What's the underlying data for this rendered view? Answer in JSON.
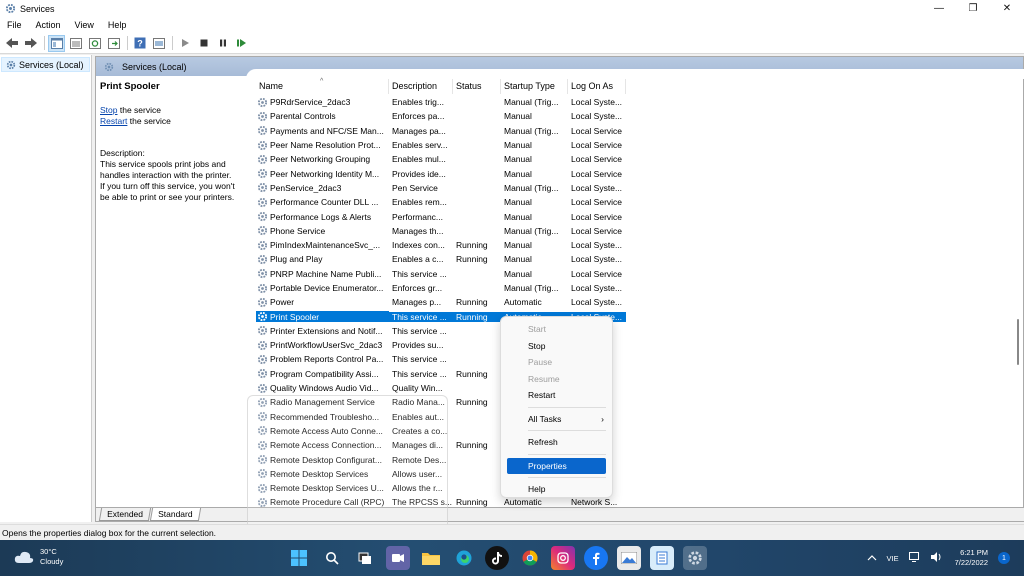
{
  "window": {
    "title": "Services",
    "minimize_glyph": "—",
    "maximize_glyph": "❐",
    "close_glyph": "✕"
  },
  "menu": [
    "File",
    "Action",
    "View",
    "Help"
  ],
  "tree": {
    "root_label": "Services (Local)"
  },
  "content": {
    "header": "Services (Local)",
    "desc_title": "Print Spooler",
    "stop_link": "Stop",
    "stop_suffix": " the service",
    "restart_link": "Restart",
    "restart_suffix": " the service",
    "description_label": "Description:",
    "description_lines": [
      "This service spools print jobs and",
      "handles interaction with the printer.",
      "If you turn off this service, you won't",
      "be able to print or see your printers."
    ]
  },
  "columns": [
    "Name",
    "Description",
    "Status",
    "Startup Type",
    "Log On As"
  ],
  "rows": [
    [
      "P9RdrService_2dac3",
      "Enables trig...",
      "",
      "Manual (Trig...",
      "Local Syste..."
    ],
    [
      "Parental Controls",
      "Enforces pa...",
      "",
      "Manual",
      "Local Syste..."
    ],
    [
      "Payments and NFC/SE Man...",
      "Manages pa...",
      "",
      "Manual (Trig...",
      "Local Service"
    ],
    [
      "Peer Name Resolution Prot...",
      "Enables serv...",
      "",
      "Manual",
      "Local Service"
    ],
    [
      "Peer Networking Grouping",
      "Enables mul...",
      "",
      "Manual",
      "Local Service"
    ],
    [
      "Peer Networking Identity M...",
      "Provides ide...",
      "",
      "Manual",
      "Local Service"
    ],
    [
      "PenService_2dac3",
      "Pen Service",
      "",
      "Manual (Trig...",
      "Local Syste..."
    ],
    [
      "Performance Counter DLL ...",
      "Enables rem...",
      "",
      "Manual",
      "Local Service"
    ],
    [
      "Performance Logs & Alerts",
      "Performanc...",
      "",
      "Manual",
      "Local Service"
    ],
    [
      "Phone Service",
      "Manages th...",
      "",
      "Manual (Trig...",
      "Local Service"
    ],
    [
      "PimIndexMaintenanceSvc_...",
      "Indexes con...",
      "Running",
      "Manual",
      "Local Syste..."
    ],
    [
      "Plug and Play",
      "Enables a c...",
      "Running",
      "Manual",
      "Local Syste..."
    ],
    [
      "PNRP Machine Name Publi...",
      "This service ...",
      "",
      "Manual",
      "Local Service"
    ],
    [
      "Portable Device Enumerator...",
      "Enforces gr...",
      "",
      "Manual (Trig...",
      "Local Syste..."
    ],
    [
      "Power",
      "Manages p...",
      "Running",
      "Automatic",
      "Local Syste..."
    ],
    [
      "Print Spooler",
      "This service ...",
      "Running",
      "Automatic",
      "Local Syste..."
    ],
    [
      "Printer Extensions and Notif...",
      "This service ...",
      "",
      "",
      ""
    ],
    [
      "PrintWorkflowUserSvc_2dac3",
      "Provides su...",
      "",
      "",
      ""
    ],
    [
      "Problem Reports Control Pa...",
      "This service ...",
      "",
      "",
      ""
    ],
    [
      "Program Compatibility Assi...",
      "This service ...",
      "Running",
      "",
      ""
    ],
    [
      "Quality Windows Audio Vid...",
      "Quality Win...",
      "",
      "",
      "ce"
    ],
    [
      "Radio Management Service",
      "Radio Mana...",
      "Running",
      "",
      "ce"
    ],
    [
      "Recommended Troublesho...",
      "Enables aut...",
      "",
      "",
      ""
    ],
    [
      "Remote Access Auto Conne...",
      "Creates a co...",
      "",
      "",
      ""
    ],
    [
      "Remote Access Connection...",
      "Manages di...",
      "Running",
      "",
      ""
    ],
    [
      "Remote Desktop Configurat...",
      "Remote Des...",
      "",
      "",
      ""
    ],
    [
      "Remote Desktop Services",
      "Allows user...",
      "",
      "",
      ""
    ],
    [
      "Remote Desktop Services U...",
      "Allows the r...",
      "",
      "",
      ""
    ],
    [
      "Remote Procedure Call (RPC)",
      "The RPCSS s...",
      "Running",
      "Automatic",
      "Network S..."
    ]
  ],
  "selected_row_index": 15,
  "tabs": [
    "Extended",
    "Standard"
  ],
  "context_menu": {
    "start": "Start",
    "stop": "Stop",
    "pause": "Pause",
    "resume": "Resume",
    "restart": "Restart",
    "all_tasks": "All Tasks",
    "refresh": "Refresh",
    "properties": "Properties",
    "help": "Help"
  },
  "status_text": "Opens the properties dialog box for the current selection.",
  "taskbar": {
    "temperature": "30°C",
    "weather": "Cloudy",
    "language": "VIE",
    "time": "6:21 PM",
    "date": "7/22/2022",
    "notification_count": "1"
  },
  "colors": {
    "selection": "#0078d7",
    "link": "#0645ad",
    "taskbar": "#21466a"
  }
}
